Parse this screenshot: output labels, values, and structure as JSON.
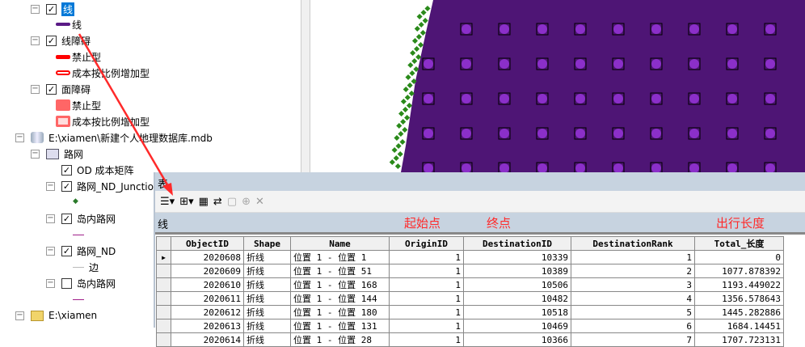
{
  "toc": {
    "layer_line": "线",
    "line_sym": "线",
    "layer_line_barriers": "线障碍",
    "lb_prohibit": "禁止型",
    "lb_scaled": "成本按比例增加型",
    "layer_poly_barriers": "面障碍",
    "pb_prohibit": "禁止型",
    "pb_scaled": "成本按比例增加型",
    "gdb": "E:\\xiamen\\新建个人地理数据库.mdb",
    "dataset": "路网",
    "fc_od": "OD 成本矩阵",
    "fc_junction": "路网_ND_Junctio",
    "fc_island": "岛内路网",
    "fc_nd": "路网_ND",
    "nd_edge": "边",
    "fc_island2": "岛内路网",
    "folder": "E:\\xiamen"
  },
  "table_window": {
    "title": "表",
    "subtitle": "线",
    "annotations": {
      "origin": "起始点",
      "destination": "终点",
      "length": "出行长度"
    },
    "columns": [
      "ObjectID",
      "Shape",
      "Name",
      "OriginID",
      "DestinationID",
      "DestinationRank",
      "Total_长度"
    ],
    "rows": [
      [
        "2020608",
        "折线",
        "位置 1 - 位置 1",
        "1",
        "10339",
        "1",
        "0"
      ],
      [
        "2020609",
        "折线",
        "位置 1 - 位置 51",
        "1",
        "10389",
        "2",
        "1077.878392"
      ],
      [
        "2020610",
        "折线",
        "位置 1 - 位置 168",
        "1",
        "10506",
        "3",
        "1193.449022"
      ],
      [
        "2020611",
        "折线",
        "位置 1 - 位置 144",
        "1",
        "10482",
        "4",
        "1356.578643"
      ],
      [
        "2020612",
        "折线",
        "位置 1 - 位置 180",
        "1",
        "10518",
        "5",
        "1445.282886"
      ],
      [
        "2020613",
        "折线",
        "位置 1 - 位置 131",
        "1",
        "10469",
        "6",
        "1684.14451"
      ],
      [
        "2020614",
        "折线",
        "位置 1 - 位置 28",
        "1",
        "10366",
        "7",
        "1707.723131"
      ]
    ]
  },
  "colors": {
    "polygon": "#4e1575",
    "point": "#8b2fc9",
    "arrow": "#ff2a2a"
  }
}
